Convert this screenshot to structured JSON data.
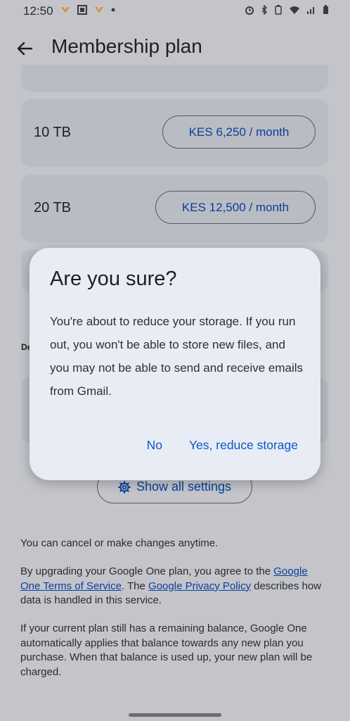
{
  "status_bar": {
    "time": "12:50"
  },
  "header": {
    "title": "Membership plan"
  },
  "plans": [
    {
      "size": "10 TB",
      "price": "KES 6,250 / month"
    },
    {
      "size": "20 TB",
      "price": "KES 12,500 / month"
    }
  ],
  "section_label": "De",
  "settings_button": "Show all settings",
  "footer": {
    "cancel_note": "You can cancel or make changes anytime.",
    "terms_prefix": "By upgrading your Google One plan, you agree to the ",
    "terms_link": "Google One Terms of Service",
    "terms_mid": ". The ",
    "privacy_link": "Google Privacy Policy",
    "terms_suffix": " describes how data is handled in this service.",
    "balance_note": "If your current plan still has a remaining balance, Google One automatically applies that balance towards any new plan you purchase. When that balance is used up, your new plan will be charged."
  },
  "dialog": {
    "title": "Are you sure?",
    "body": "You're about to reduce your storage. If you run out, you won't be able to store new files, and you may not be able to send and receive emails from Gmail.",
    "no_label": "No",
    "yes_label": "Yes, reduce storage"
  },
  "colors": {
    "accent": "#0b57d0",
    "scrim": "#c3c5cb",
    "dialog_bg": "#e8ecf4"
  }
}
